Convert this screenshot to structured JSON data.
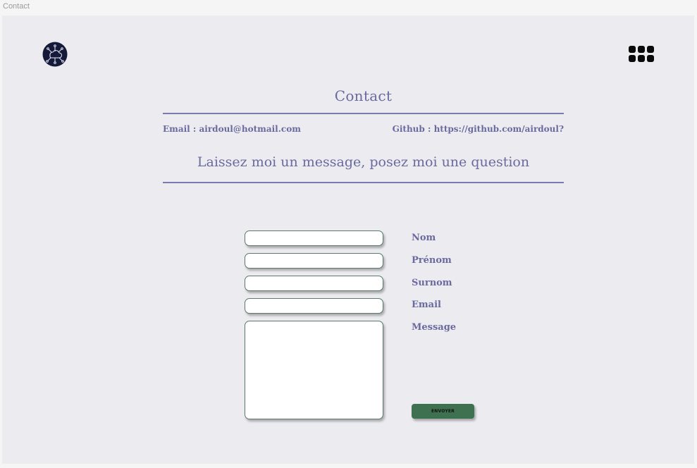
{
  "window": {
    "title": "Contact"
  },
  "header": {
    "logo_icon": "circuit-cloud-logo-icon",
    "menu_icon": "grid-menu-icon"
  },
  "main": {
    "title": "Contact",
    "email_line": "Email : airdoul@hotmail.com",
    "github_line": "Github : https://github.com/airdoul?",
    "subtitle": "Laissez moi un message, posez moi une question"
  },
  "form": {
    "fields": [
      {
        "label": "Nom",
        "value": ""
      },
      {
        "label": "Prénom",
        "value": ""
      },
      {
        "label": "Surnom",
        "value": ""
      },
      {
        "label": "Email",
        "value": ""
      },
      {
        "label": "Message",
        "value": ""
      }
    ],
    "submit_label": "ENVOYER"
  },
  "colors": {
    "canvas_bg": "#ebebf0",
    "text_accent": "#6a6a9f",
    "rule": "#7a7cae",
    "button_bg": "#3e7150",
    "logo_bg": "#141a38"
  }
}
